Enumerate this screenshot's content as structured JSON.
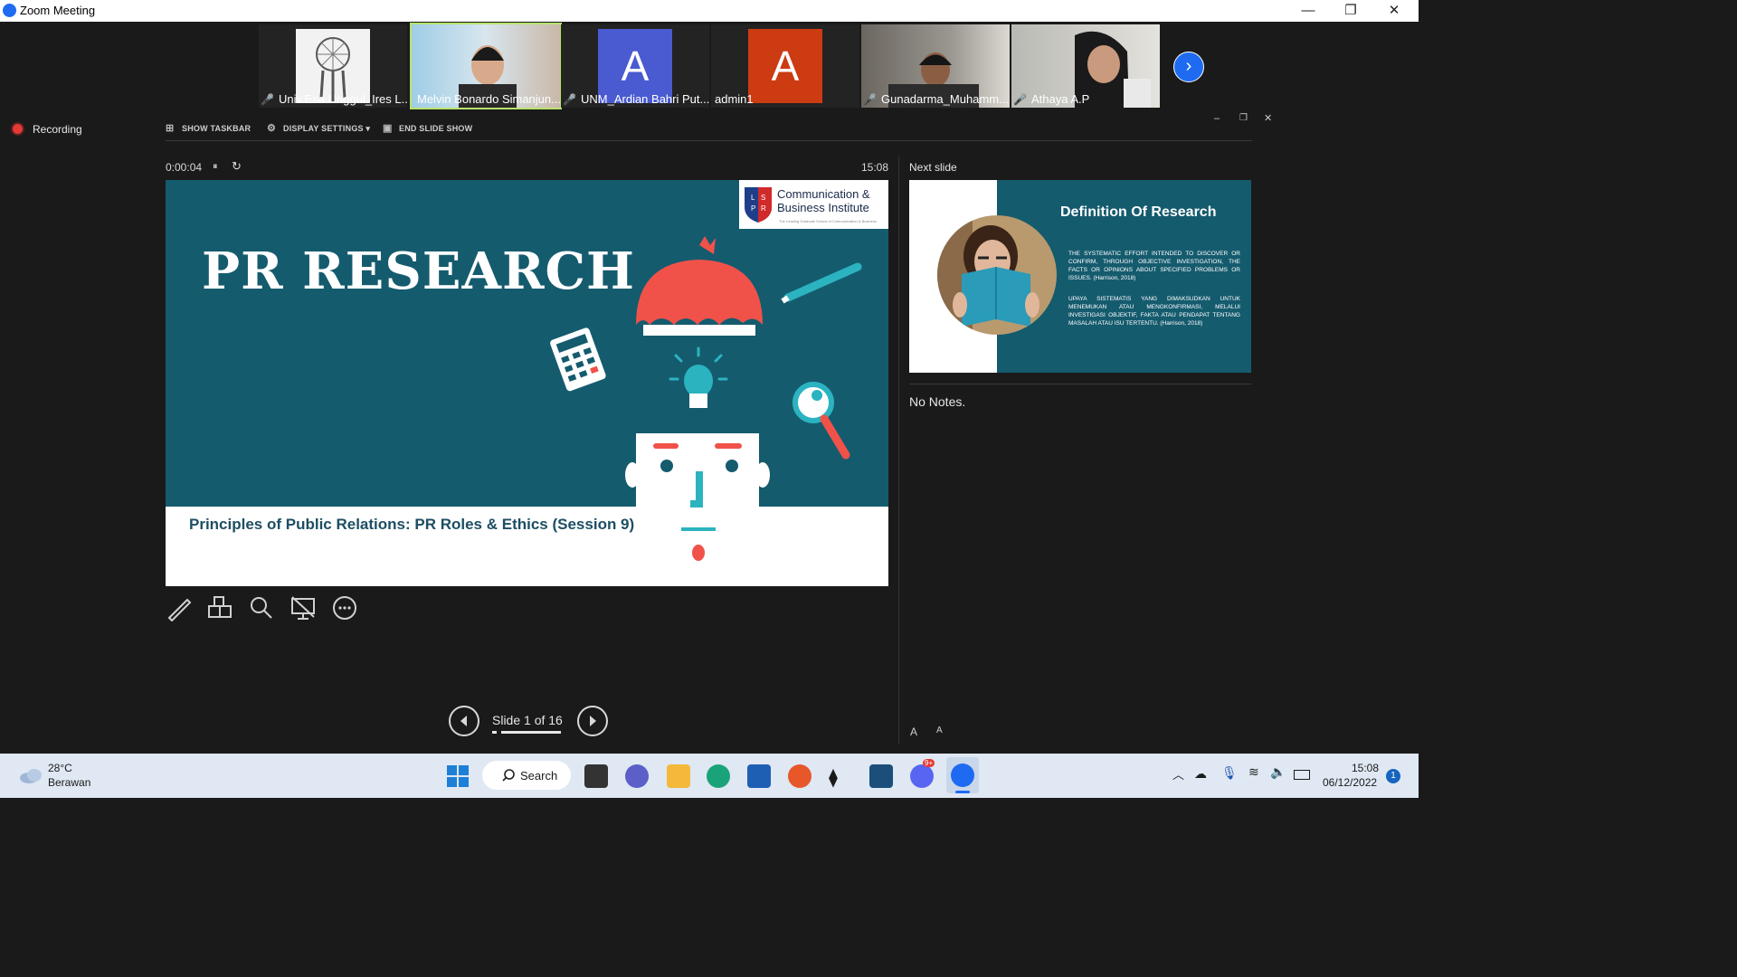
{
  "window": {
    "title": "Zoom Meeting",
    "minimize": "—",
    "restore": "❐",
    "close": "✕"
  },
  "participants": [
    {
      "name": "Univ.Esa Unggul_Ires L...",
      "muted": true
    },
    {
      "name": "Melvin Bonardo Simanjun...",
      "muted": false,
      "active": true
    },
    {
      "name": "UNM_Ardian Bahri Put...",
      "muted": true,
      "avatar_letter": "A",
      "avatar_color": "#4a5ad0"
    },
    {
      "name": "admin1",
      "muted": false,
      "avatar_letter": "A",
      "avatar_color": "#cc3b12"
    },
    {
      "name": "Gunadarma_Muhamm...",
      "muted": true
    },
    {
      "name": "Athaya A.P",
      "muted": true
    }
  ],
  "recording": {
    "label": "Recording"
  },
  "presenter_toolbar": {
    "show_taskbar": "SHOW TASKBAR",
    "display_settings": "DISPLAY SETTINGS ▾",
    "end_slide_show": "END SLIDE SHOW"
  },
  "presenter": {
    "elapsed": "0:00:04",
    "clock": "15:08",
    "next_slide_label": "Next slide",
    "notes": "No Notes."
  },
  "slide": {
    "title": "PR RESEARCH",
    "subtitle": "Principles of Public Relations: PR Roles & Ethics (Session 9)",
    "logo_line1": "Communication &",
    "logo_line2": "Business Institute",
    "logo_tag": "The Leading Graduate School of Communication & Business",
    "logo_letters": "LSPR"
  },
  "next_slide": {
    "title": "Definition Of Research",
    "p1": "THE SYSTEMATIC EFFORT INTENDED TO DISCOVER OR CONFIRM, THROUGH OBJECTIVE INVESTIGATION, THE FACTS OR OPINIONS ABOUT SPECIFIED PROBLEMS OR ISSUES. (Harrison, 2018)",
    "p2": "UPAYA SISTEMATIS YANG DIMAKSUDKAN UNTUK MENEMUKAN ATAU MENGKONFIRMASI, MELALUI INVESTIGASI OBJEKTIF, FAKTA ATAU PENDAPAT TENTANG MASALAH ATAU ISU TERTENTU. (Harrison, 2018)"
  },
  "navigation": {
    "slide_counter": "Slide 1 of 16",
    "progress": 0.0625
  },
  "notes_font": {
    "increase": "A",
    "decrease": "A"
  },
  "taskbar": {
    "weather_temp": "28°C",
    "weather_desc": "Berawan",
    "search_label": "Search",
    "time": "15:08",
    "date": "06/12/2022",
    "notification_count": "1",
    "discord_badge": "9+"
  },
  "colors": {
    "slide_bg": "#155b6e",
    "accent_red": "#f0524a",
    "accent_teal": "#2bb3c0",
    "zoom_blue": "#1e6bf2"
  }
}
